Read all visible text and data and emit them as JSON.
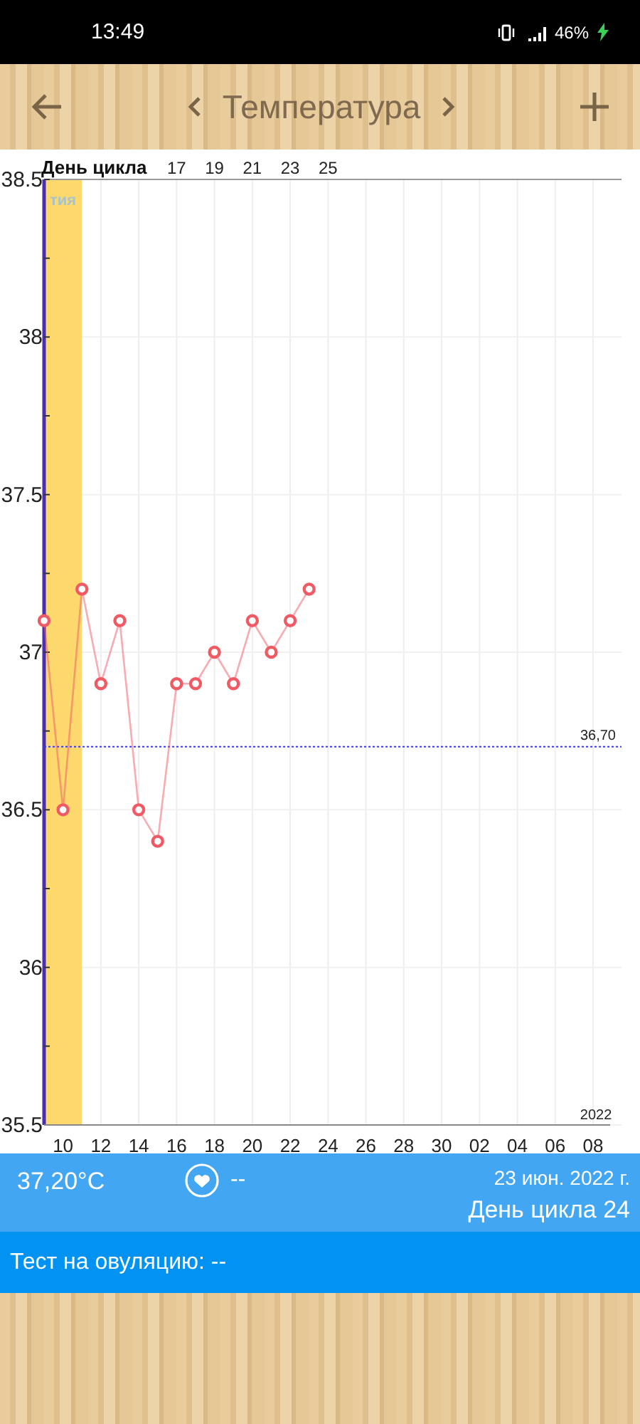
{
  "status_bar": {
    "time": "13:49",
    "battery": "46%"
  },
  "header": {
    "title": "Температура"
  },
  "chart": {
    "top_axis": {
      "title": "День цикла",
      "tick_labels": [
        "17",
        "19",
        "21",
        "23",
        "25"
      ]
    },
    "year_label": "2022",
    "chart_data": {
      "type": "line",
      "grid": true,
      "x": [
        "2022-06-09",
        "2022-06-10",
        "2022-06-11",
        "2022-06-12",
        "2022-06-13",
        "2022-06-14",
        "2022-06-15",
        "2022-06-16",
        "2022-06-17",
        "2022-06-18",
        "2022-06-19",
        "2022-06-20",
        "2022-06-21",
        "2022-06-22",
        "2022-06-23"
      ],
      "series": [
        {
          "color": "#f05a64",
          "marker": "circle",
          "values": [
            37.1,
            36.5,
            37.2,
            36.9,
            37.1,
            36.5,
            36.4,
            36.9,
            36.9,
            37.0,
            36.9,
            37.1,
            37.0,
            37.1,
            37.2
          ]
        }
      ],
      "xlim": [
        "2022-06-09",
        "2022-07-09"
      ],
      "ylim": [
        35.5,
        38.5
      ],
      "xticks": [
        {
          "value": "2022-06-10",
          "label": "10"
        },
        {
          "value": "2022-06-12",
          "label": "12"
        },
        {
          "value": "2022-06-14",
          "label": "14"
        },
        {
          "value": "2022-06-16",
          "label": "16"
        },
        {
          "value": "2022-06-18",
          "label": "18"
        },
        {
          "value": "2022-06-20",
          "label": "20"
        },
        {
          "value": "2022-06-22",
          "label": "22"
        },
        {
          "value": "2022-06-24",
          "label": "24"
        },
        {
          "value": "2022-06-26",
          "label": "26"
        },
        {
          "value": "2022-06-28",
          "label": "28"
        },
        {
          "value": "2022-06-30",
          "label": "30"
        },
        {
          "value": "2022-07-02",
          "label": "02"
        },
        {
          "value": "2022-07-04",
          "label": "04"
        },
        {
          "value": "2022-07-06",
          "label": "06"
        },
        {
          "value": "2022-07-08",
          "label": "08"
        }
      ],
      "yticks": [
        {
          "value": 35.5,
          "label": "35.5"
        },
        {
          "value": 36,
          "label": "36"
        },
        {
          "value": 36.5,
          "label": "36.5"
        },
        {
          "value": 37,
          "label": "37"
        },
        {
          "value": 37.5,
          "label": "37.5"
        },
        {
          "value": 38,
          "label": "38"
        },
        {
          "value": 38.5,
          "label": "38.5"
        }
      ],
      "bands": [
        {
          "axis": "x",
          "from": "2022-06-09",
          "to": "2022-06-11",
          "label": "тия",
          "color": "#fcd86d"
        }
      ],
      "ref_lines": [
        {
          "axis": "y",
          "value": 36.7,
          "label": "36,70",
          "color": "#3b3be0"
        }
      ]
    }
  },
  "summary": {
    "temperature": "37,20°C",
    "heart_value": "--",
    "date": "23 июн. 2022 г.",
    "cycle_day": "День цикла 24"
  },
  "ovulation_test": {
    "text": "Тест на овуляцию: --"
  }
}
